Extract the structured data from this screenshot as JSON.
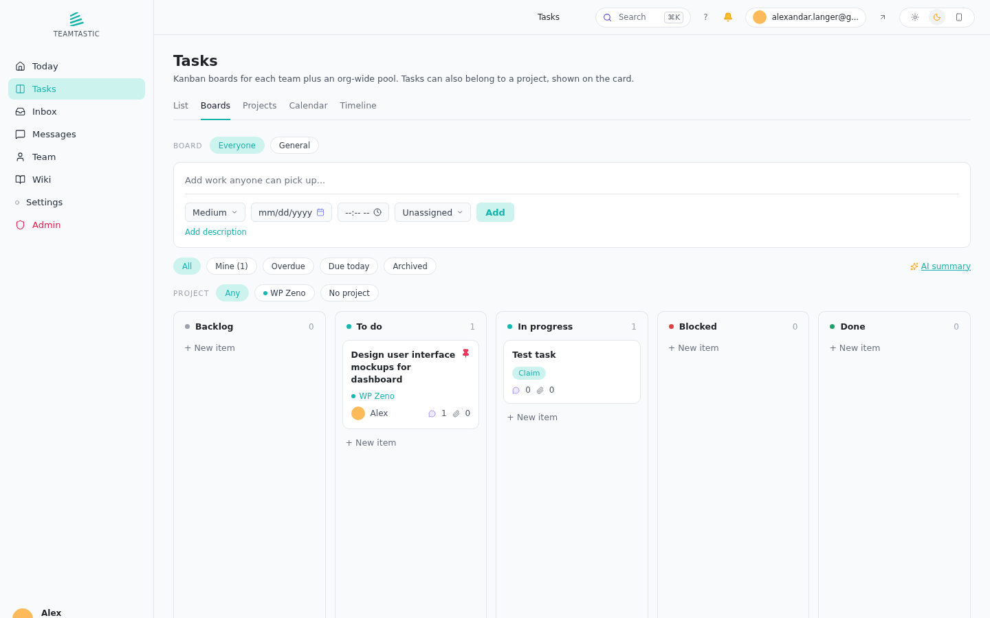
{
  "header": {
    "title": "Tasks",
    "search": {
      "placeholder": "Search",
      "shortcut": "⌘K"
    },
    "help": "?",
    "user_email": "alexandar.langer@g...",
    "theme_modes": [
      {
        "kind": "light",
        "selected": false
      },
      {
        "kind": "dark",
        "selected": true
      },
      {
        "kind": "system",
        "selected": false
      }
    ]
  },
  "sidebar": {
    "logo": "TEAMTASTIC",
    "items": [
      {
        "label": "Today",
        "kind": "nav",
        "selected": false
      },
      {
        "label": "Tasks",
        "kind": "nav",
        "selected": true
      },
      {
        "label": "Inbox",
        "kind": "nav",
        "selected": false
      },
      {
        "label": "Messages",
        "kind": "nav",
        "selected": false
      },
      {
        "label": "Team",
        "kind": "nav",
        "selected": false
      },
      {
        "label": "Wiki",
        "kind": "nav",
        "selected": false
      },
      {
        "label": "Settings",
        "kind": "nav",
        "selected": false
      },
      {
        "label": "Admin",
        "kind": "admin",
        "selected": false
      }
    ],
    "user": {
      "name": "Alex"
    }
  },
  "page": {
    "title": "Tasks",
    "description": "Kanban boards for each team plus an org-wide pool. Tasks can also belong to a project, shown on the card.",
    "tabs": [
      {
        "label": "List",
        "selected": false
      },
      {
        "label": "Boards",
        "selected": true
      },
      {
        "label": "Projects",
        "selected": false
      },
      {
        "label": "Calendar",
        "selected": false
      },
      {
        "label": "Timeline",
        "selected": false
      }
    ],
    "board_filter": {
      "label": "BOARD",
      "options": [
        {
          "label": "Everyone",
          "selected": true
        },
        {
          "label": "General",
          "selected": false
        }
      ]
    },
    "composer": {
      "placeholder": "Add work anyone can pick up...",
      "priority": "Medium",
      "date_placeholder": "mm/dd/yyyy",
      "time_placeholder": "--:-- --",
      "assignee": "Unassigned",
      "add_button": "Add",
      "add_description": "Add description"
    },
    "filters": [
      {
        "label": "All",
        "selected": true
      },
      {
        "label": "Mine (1)",
        "selected": false
      },
      {
        "label": "Overdue",
        "selected": false
      },
      {
        "label": "Due today",
        "selected": false
      },
      {
        "label": "Archived",
        "selected": false
      }
    ],
    "ai_summary": "AI summary",
    "project_filter": {
      "label": "PROJECT",
      "options": [
        {
          "label": "Any",
          "selected": true
        },
        {
          "label": "WP Zeno",
          "selected": false,
          "color": "#14b8b0"
        },
        {
          "label": "No project",
          "selected": false
        }
      ]
    },
    "columns": [
      {
        "name": "Backlog",
        "count": "0",
        "color": "#9ca3af",
        "new_item": "+ New item"
      },
      {
        "name": "To do",
        "count": "1",
        "color": "#14b8b0",
        "cards": [
          {
            "title": "Design user interface mockups for dashboard",
            "pinned": true,
            "project": {
              "name": "WP Zeno",
              "color": "#14b8b0"
            },
            "assignee": "Alex",
            "comments": "1",
            "attachments": "0"
          }
        ],
        "new_item": "+ New item"
      },
      {
        "name": "In progress",
        "count": "1",
        "color": "#14b8b0",
        "cards": [
          {
            "title": "Test task",
            "pinned": false,
            "claim": "Claim",
            "comments": "0",
            "attachments": "0"
          }
        ],
        "new_item": "+ New item"
      },
      {
        "name": "Blocked",
        "count": "0",
        "color": "#dc4444",
        "new_item": "+ New item"
      },
      {
        "name": "Done",
        "count": "0",
        "color": "#22a06b",
        "new_item": "+ New item"
      }
    ]
  }
}
